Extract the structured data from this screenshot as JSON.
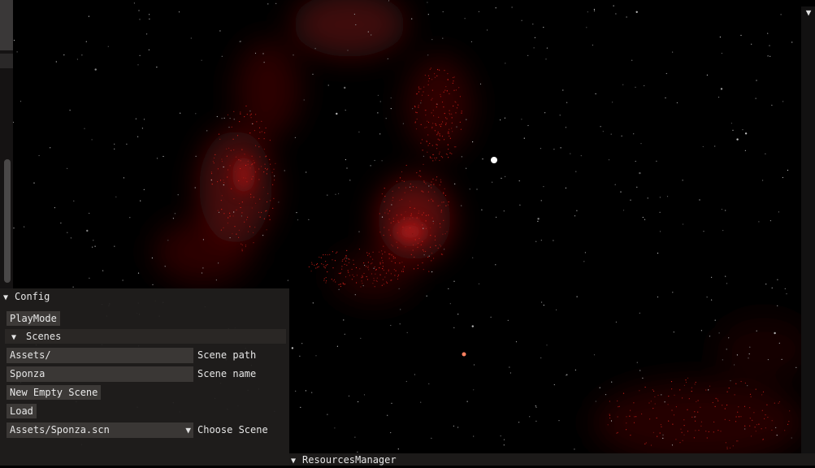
{
  "config": {
    "title": "Config",
    "playmode_label": "PlayMode",
    "scenes": {
      "title": "Scenes",
      "path_value": "Assets/",
      "path_label": "Scene path",
      "name_value": "Sponza",
      "name_label": "Scene name",
      "new_empty_label": "New Empty Scene",
      "load_label": "Load",
      "selected_scene": "Assets/Sponza.scn",
      "choose_label": "Choose Scene"
    }
  },
  "resources_manager": {
    "title": "ResourcesManager"
  },
  "icons": {
    "expand": "triangle-down-icon"
  },
  "colors": {
    "panel_bg": "#201e1d",
    "nebula": "#c0201a",
    "button_bg": "#3c3937"
  }
}
